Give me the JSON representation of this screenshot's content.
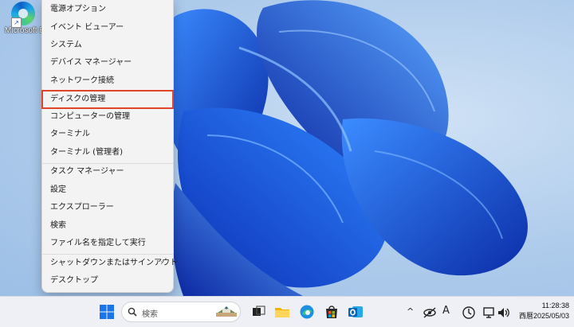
{
  "desktop": {
    "icon_label": "Microsoft Edge"
  },
  "menu": {
    "items": [
      {
        "label": "電源オプション"
      },
      {
        "label": "イベント ビューアー"
      },
      {
        "label": "システム"
      },
      {
        "label": "デバイス マネージャー"
      },
      {
        "label": "ネットワーク接続"
      },
      {
        "label": "ディスクの管理",
        "highlighted": true
      },
      {
        "label": "コンピューターの管理"
      },
      {
        "label": "ターミナル"
      },
      {
        "label": "ターミナル (管理者)"
      },
      {
        "label": "タスク マネージャー"
      },
      {
        "label": "設定"
      },
      {
        "label": "エクスプローラー"
      },
      {
        "label": "検索"
      },
      {
        "label": "ファイル名を指定して実行"
      },
      {
        "label": "シャットダウンまたはサインアウト",
        "submenu": true
      },
      {
        "label": "デスクトップ"
      }
    ],
    "chevron": "›"
  },
  "taskbar": {
    "search_placeholder": "検索",
    "clock_time": "11:28:38",
    "clock_date": "西暦2025/05/03",
    "tray_ime": "A",
    "tray_chevron": "^"
  },
  "colors": {
    "highlight_outline": "#e0452b",
    "pointer_arrow": "#e8532f",
    "bloom_dark": "#0a2fb8",
    "bloom_light": "#2a7cf0"
  }
}
